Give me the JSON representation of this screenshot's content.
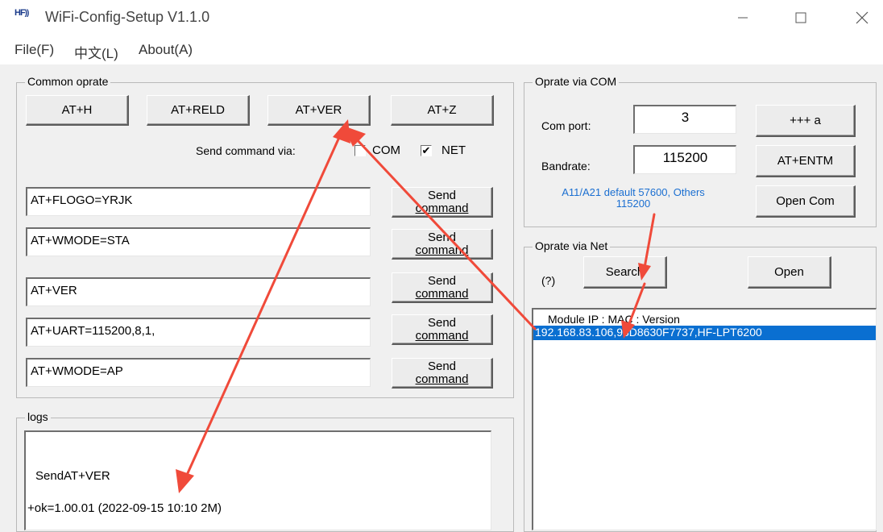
{
  "window": {
    "logo_text": "HF",
    "title": "WiFi-Config-Setup V1.1.0"
  },
  "menu": {
    "file": "File(F)",
    "language": "中文(L)",
    "about": "About(A)"
  },
  "common": {
    "group_label": "Common oprate",
    "btn_h": "AT+H",
    "btn_reld": "AT+RELD",
    "btn_ver": "AT+VER",
    "btn_z": "AT+Z",
    "send_via_label": "Send command via:",
    "com_label": "COM",
    "net_label": "NET",
    "net_checked": "✔",
    "send_line1": "Send",
    "send_line2": "command",
    "commands": [
      "AT+FLOGO=YRJK",
      "AT+WMODE=STA",
      "AT+VER",
      "AT+UART=115200,8,1,",
      "AT+WMODE=AP"
    ]
  },
  "logs": {
    "group_label": "logs",
    "line1": "SendAT+VER",
    "line2": "+ok=1.00.01 (2022-09-15 10:10 2M)"
  },
  "com": {
    "group_label": "Oprate via COM",
    "port_label": "Com port:",
    "port_value": "3",
    "baud_label": "Bandrate:",
    "baud_value": "115200",
    "btn_plus": "+++ a",
    "btn_entm": "AT+ENTM",
    "btn_open": "Open Com",
    "hint_line1": "A11/A21 default 57600, Others",
    "hint_line2": "115200"
  },
  "net": {
    "group_label": "Oprate via Net",
    "help": "(?)",
    "btn_search": "Search",
    "btn_open": "Open",
    "list_header": "Module IP   :  MAC  :  Version",
    "selected_row": "192.168.83.106,98D8630F7737,HF-LPT6200"
  },
  "colors": {
    "annotation_arrow": "#f04a3a",
    "selection": "#0a6fd1",
    "hint_text": "#1b6fd1"
  }
}
